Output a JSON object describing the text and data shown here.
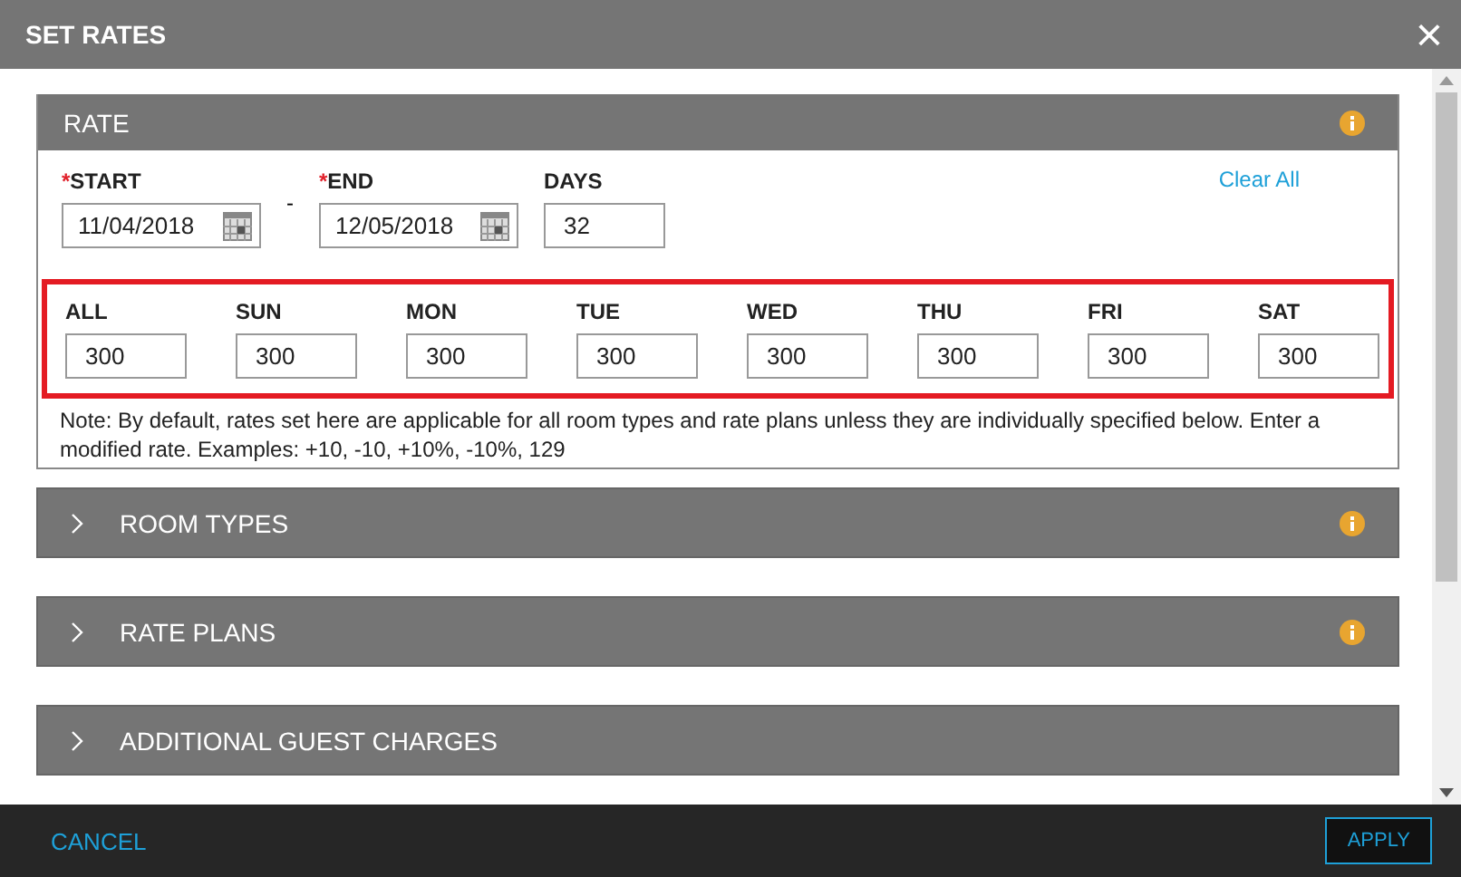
{
  "window": {
    "title": "SET RATES",
    "close": "×"
  },
  "rate_panel": {
    "title": "RATE",
    "info": true,
    "clear_all": "Clear All",
    "separator": "-",
    "date_fields": [
      {
        "label": "START",
        "required": true,
        "value": "11/04/2018",
        "kind": "date"
      },
      {
        "label": "END",
        "required": true,
        "value": "12/05/2018",
        "kind": "date"
      },
      {
        "label": "DAYS",
        "required": false,
        "value": "32",
        "kind": "number"
      }
    ],
    "required_mark": "*",
    "day_rates": [
      {
        "label": "ALL",
        "value": "300"
      },
      {
        "label": "SUN",
        "value": "300"
      },
      {
        "label": "MON",
        "value": "300"
      },
      {
        "label": "TUE",
        "value": "300"
      },
      {
        "label": "WED",
        "value": "300"
      },
      {
        "label": "THU",
        "value": "300"
      },
      {
        "label": "FRI",
        "value": "300"
      },
      {
        "label": "SAT",
        "value": "300"
      }
    ],
    "note": "Note: By default, rates set here are applicable for all room types and rate plans unless they are individually specified below. Enter a modified rate. Examples: +10, -10, +10%, -10%, 129"
  },
  "sections": [
    {
      "title": "ROOM TYPES",
      "info": true
    },
    {
      "title": "RATE PLANS",
      "info": true
    },
    {
      "title": "ADDITIONAL GUEST CHARGES",
      "info": false
    }
  ],
  "footer": {
    "cancel": "CANCEL",
    "apply": "APPLY"
  }
}
